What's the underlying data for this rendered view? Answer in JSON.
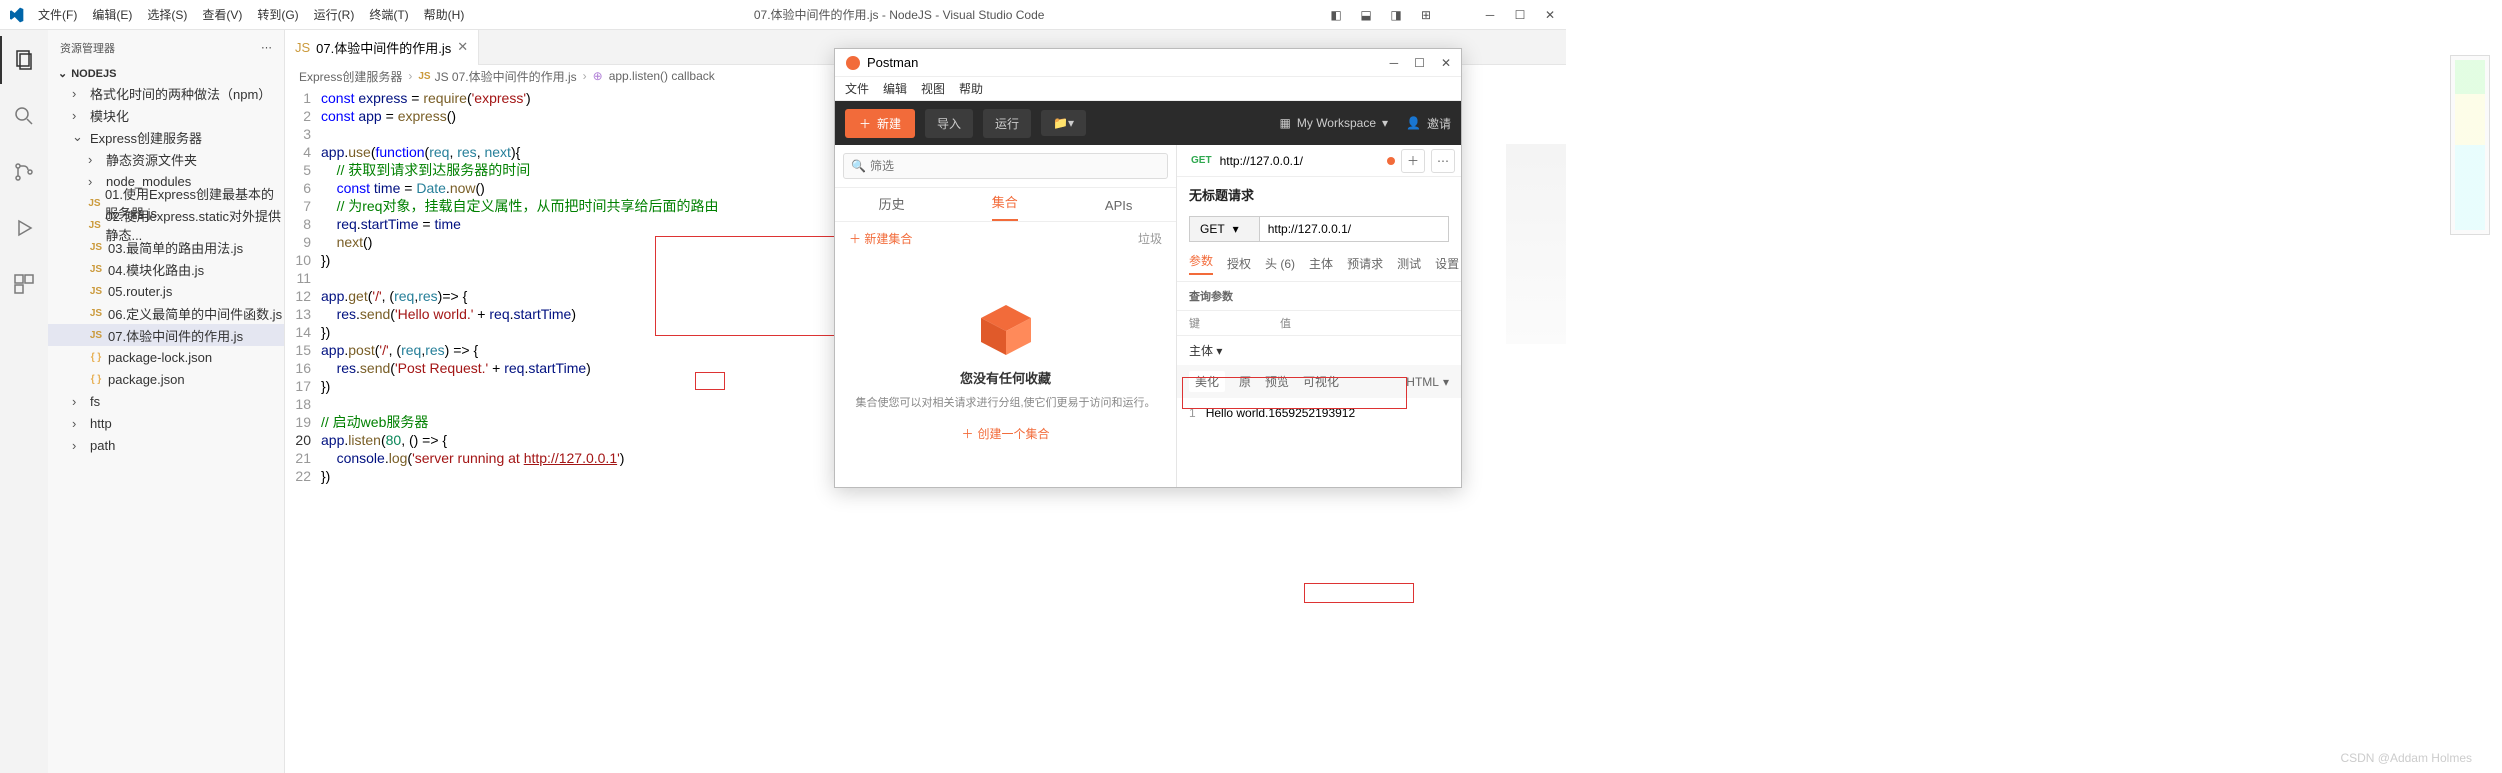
{
  "titlebar": {
    "menus": [
      "文件(F)",
      "编辑(E)",
      "选择(S)",
      "查看(V)",
      "转到(G)",
      "运行(R)",
      "终端(T)",
      "帮助(H)"
    ],
    "title": "07.体验中间件的作用.js - NodeJS - Visual Studio Code"
  },
  "sidebar": {
    "header": "资源管理器",
    "root": "NODEJS",
    "items": [
      {
        "label": "格式化时间的两种做法（npm）",
        "type": "folder",
        "depth": 1,
        "open": false,
        "chev": "›"
      },
      {
        "label": "模块化",
        "type": "folder",
        "depth": 1,
        "open": false,
        "chev": "›"
      },
      {
        "label": "Express创建服务器",
        "type": "folder",
        "depth": 1,
        "open": true,
        "chev": "⌄"
      },
      {
        "label": "静态资源文件夹",
        "type": "folder",
        "depth": 2,
        "open": false,
        "chev": "›"
      },
      {
        "label": "node_modules",
        "type": "folder",
        "depth": 2,
        "open": false,
        "chev": "›"
      },
      {
        "label": "01.使用Express创建最基本的服务器.js",
        "type": "js",
        "depth": 2
      },
      {
        "label": "02.使用express.static对外提供静态...",
        "type": "js",
        "depth": 2
      },
      {
        "label": "03.最简单的路由用法.js",
        "type": "js",
        "depth": 2
      },
      {
        "label": "04.模块化路由.js",
        "type": "js",
        "depth": 2
      },
      {
        "label": "05.router.js",
        "type": "js",
        "depth": 2
      },
      {
        "label": "06.定义最简单的中间件函数.js",
        "type": "js",
        "depth": 2
      },
      {
        "label": "07.体验中间件的作用.js",
        "type": "js",
        "depth": 2,
        "selected": true
      },
      {
        "label": "package-lock.json",
        "type": "json",
        "depth": 2
      },
      {
        "label": "package.json",
        "type": "json",
        "depth": 2
      },
      {
        "label": "fs",
        "type": "folder",
        "depth": 1,
        "open": false,
        "chev": "›"
      },
      {
        "label": "http",
        "type": "folder",
        "depth": 1,
        "open": false,
        "chev": "›"
      },
      {
        "label": "path",
        "type": "folder",
        "depth": 1,
        "open": false,
        "chev": "›"
      }
    ]
  },
  "editor": {
    "tab": {
      "icon": "JS",
      "label": "07.体验中间件的作用.js"
    },
    "breadcrumb": [
      "Express创建服务器",
      "JS 07.体验中间件的作用.js",
      "app.listen() callback"
    ],
    "lines": [
      {
        "n": 1,
        "html": "<span class='kw'>const</span> <span class='var'>express</span> = <span class='fn'>require</span>(<span class='str'>'express'</span>)"
      },
      {
        "n": 2,
        "html": "<span class='kw'>const</span> <span class='var'>app</span> = <span class='fn'>express</span>()"
      },
      {
        "n": 3,
        "html": ""
      },
      {
        "n": 4,
        "html": "<span class='var'>app</span>.<span class='fn'>use</span>(<span class='kw'>function</span>(<span class='prm'>req</span>, <span class='prm'>res</span>, <span class='prm'>next</span>){"
      },
      {
        "n": 5,
        "html": "    <span class='cmt'>// 获取到请求到达服务器的时间</span>"
      },
      {
        "n": 6,
        "html": "    <span class='kw'>const</span> <span class='var'>time</span> = <span class='prm'>Date</span>.<span class='fn'>now</span>()"
      },
      {
        "n": 7,
        "html": "    <span class='cmt'>// 为req对象，挂载自定义属性，从而把时间共享给后面的路由</span>"
      },
      {
        "n": 8,
        "html": "    <span class='var'>req</span>.<span class='var'>startTime</span> = <span class='var'>time</span>"
      },
      {
        "n": 9,
        "html": "    <span class='fn'>next</span>()"
      },
      {
        "n": 10,
        "html": "})"
      },
      {
        "n": 11,
        "html": ""
      },
      {
        "n": 12,
        "html": "<span class='var'>app</span>.<span class='fn'>get</span>(<span class='str'>'/'</span>, (<span class='prm'>req</span>,<span class='prm'>res</span>)=> {"
      },
      {
        "n": 13,
        "html": "    <span class='var'>res</span>.<span class='fn'>send</span>(<span class='str'>'Hello world.'</span> + <span class='var'>req</span>.<span class='var'>startTime</span>)"
      },
      {
        "n": 14,
        "html": "})"
      },
      {
        "n": 15,
        "html": "<span class='var'>app</span>.<span class='fn'>post</span>(<span class='str'>'/'</span>, (<span class='prm'>req</span>,<span class='prm'>res</span>) => {"
      },
      {
        "n": 16,
        "html": "    <span class='var'>res</span>.<span class='fn'>send</span>(<span class='str'>'Post Request.'</span> + <span class='var'>req</span>.<span class='var'>startTime</span>)"
      },
      {
        "n": 17,
        "html": "})"
      },
      {
        "n": 18,
        "html": ""
      },
      {
        "n": 19,
        "html": "<span class='cmt'>// 启动web服务器</span>"
      },
      {
        "n": 20,
        "html": "<span class='var'>app</span>.<span class='fn'>listen</span>(<span class='num'>80</span>, () => {",
        "cur": true
      },
      {
        "n": 21,
        "html": "    <span class='var'>console</span>.<span class='fn'>log</span>(<span class='str'>'server running at <span class='url'>http://127.0.0.1</span>'</span>)"
      },
      {
        "n": 22,
        "html": "})"
      }
    ]
  },
  "postman": {
    "title": "Postman",
    "menus": [
      "文件",
      "编辑",
      "视图",
      "帮助"
    ],
    "toolbar": {
      "new": "新建",
      "import": "导入",
      "run": "运行",
      "ws": "My Workspace",
      "invite": "邀请"
    },
    "search_ph": "筛选",
    "sidetabs": {
      "history": "历史",
      "collections": "集合",
      "apis": "APIs"
    },
    "newcol": "新建集合",
    "trash": "垃圾",
    "empty": {
      "title": "您没有任何收藏",
      "desc": "集合使您可以对相关请求进行分组,使它们更易于访问和运行。",
      "create": "创建一个集合"
    },
    "reqtab": {
      "method": "GET",
      "url": "http://127.0.0.1/"
    },
    "reqname": "无标题请求",
    "req": {
      "method": "GET",
      "url": "http://127.0.0.1/"
    },
    "paramtabs": [
      "参数",
      "授权",
      "头 (6)",
      "主体",
      "预请求",
      "测试",
      "设置"
    ],
    "paramhdr": "查询参数",
    "tablehdr": {
      "k": "键",
      "v": "值"
    },
    "bodylbl": "主体",
    "resptabs": {
      "pretty": "美化",
      "raw": "原",
      "preview": "预览",
      "vis": "可视化",
      "html": "HTML"
    },
    "resp": {
      "ln": "1",
      "text": "Hello world.1659252193912"
    }
  },
  "watermark": "CSDN @Addam Holmes"
}
